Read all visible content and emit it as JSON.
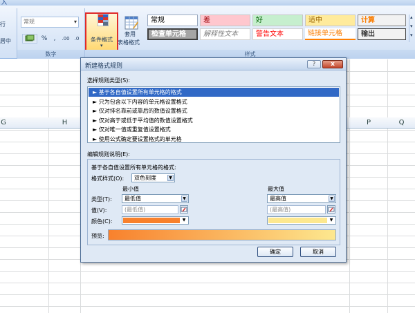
{
  "ribbon": {
    "title_fragment": "入",
    "number_format": "常规",
    "number_group_label": "数字",
    "style_group_label": "样式",
    "left_label_1": "行",
    "left_label_2": "居中",
    "percent": "%",
    "comma": ",",
    "inc_decimal": ".00",
    "dec_decimal": ".0",
    "conditional_format": "条件格式",
    "table_format": "套用\n表格格式",
    "table_format_line1": "套用",
    "table_format_line2": "表格格式",
    "styles": {
      "normal": "常规",
      "bad": "差",
      "good": "好",
      "neutral": "适中",
      "calc": "计算",
      "check_cell": "检查单元格",
      "explanatory": "解释性文本",
      "warning": "警告文本",
      "linked_cell": "链接单元格",
      "output": "输出"
    },
    "accent_color": "#e02a2a"
  },
  "sheet": {
    "columns": [
      "G",
      "H",
      "P",
      "Q"
    ]
  },
  "dialog": {
    "title": "新建格式规则",
    "help": "?",
    "close": "x",
    "rule_type_label": "选择规则类型(S):",
    "rule_types": [
      "基于各自值设置所有单元格的格式",
      "只为包含以下内容的单元格设置格式",
      "仅对排名靠前或靠后的数值设置格式",
      "仅对高于或低于平均值的数值设置格式",
      "仅对唯一值或重复值设置格式",
      "使用公式确定要设置格式的单元格"
    ],
    "selected_rule_index": 0,
    "edit_label": "编辑规则说明(E):",
    "edit_heading": "基于各自值设置所有单元格的格式:",
    "format_style_label": "格式样式(O):",
    "format_style_value": "双色刻度",
    "min_label": "最小值",
    "max_label": "最大值",
    "type_label": "类型(T):",
    "value_label": "值(V):",
    "color_label": "颜色(C):",
    "preview_label": "预览:",
    "min_type": "最低值",
    "max_type": "最高值",
    "min_value": "(最低值)",
    "max_value": "(最高值)",
    "min_color": "#f8812d",
    "max_color": "#fde88f",
    "ok": "确定",
    "cancel": "取消"
  }
}
